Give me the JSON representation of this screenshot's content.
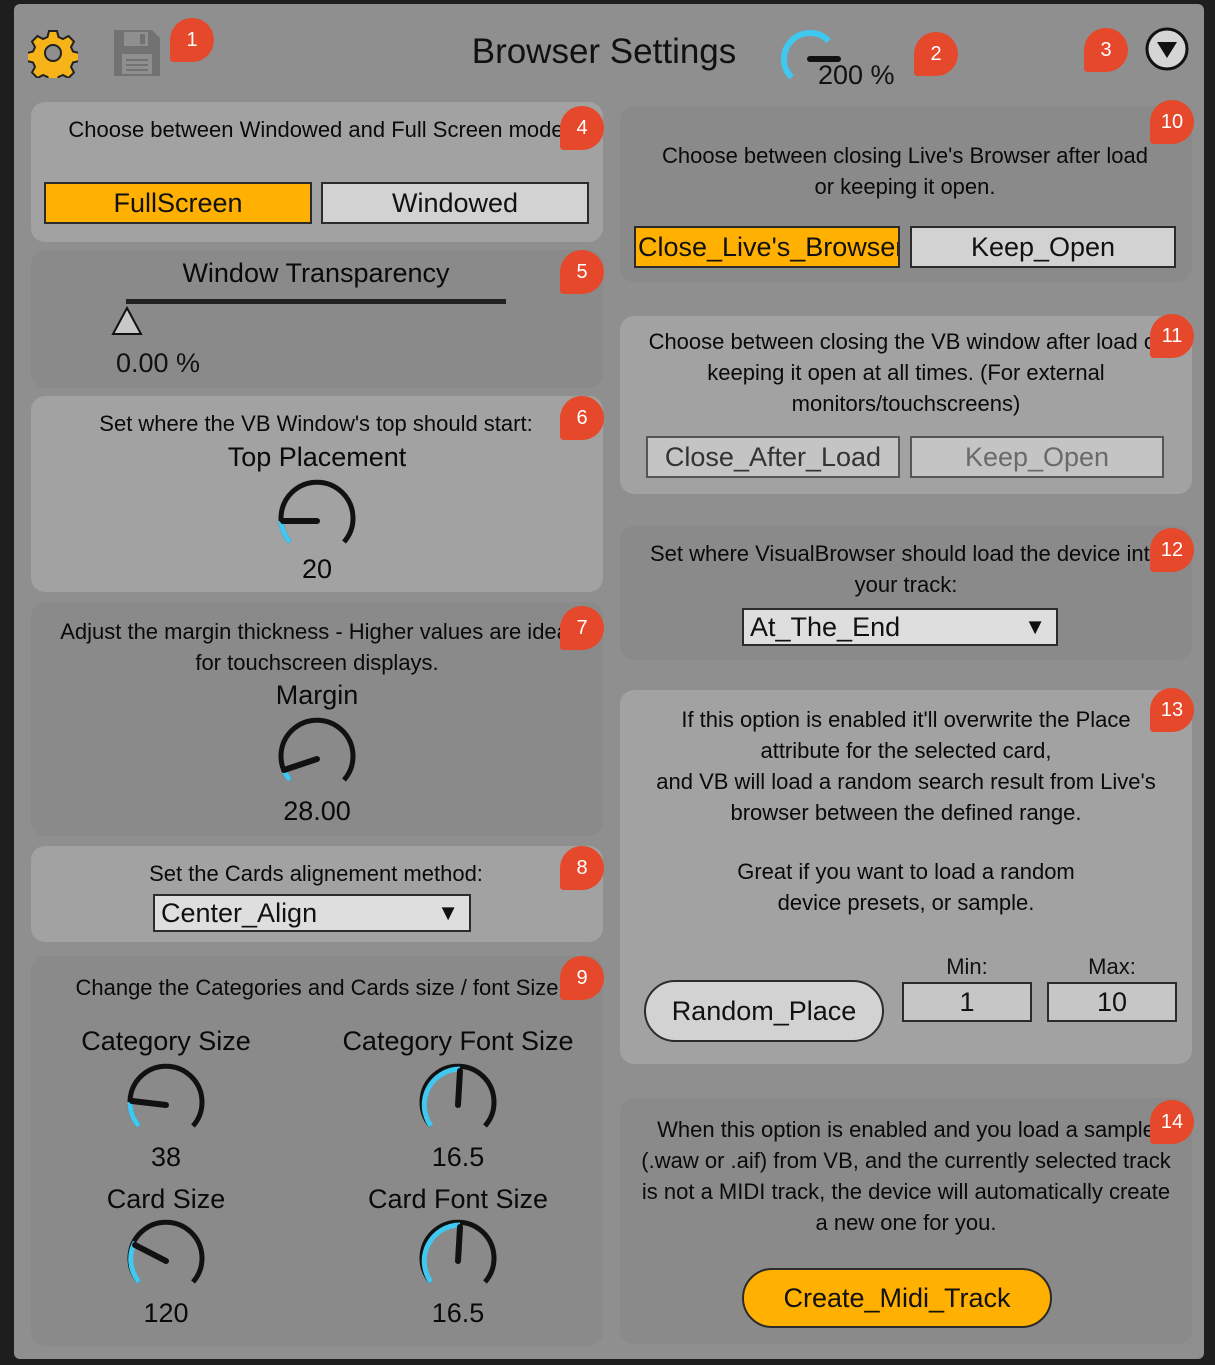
{
  "header": {
    "title": "Browser Settings",
    "zoom": "200 %",
    "icons": [
      "gear-icon",
      "save-icon",
      "collapse-down-icon"
    ]
  },
  "badges": [
    "1",
    "2",
    "3",
    "4",
    "5",
    "6",
    "7",
    "8",
    "9",
    "10",
    "11",
    "12",
    "13",
    "14"
  ],
  "screen_mode": {
    "text": "Choose between Windowed and Full Screen mode",
    "options": [
      "FullScreen",
      "Windowed"
    ],
    "selected": "FullScreen"
  },
  "transparency": {
    "label": "Window Transparency",
    "value": "0.00 %",
    "fraction": 0.0
  },
  "top_placement": {
    "text": "Set where the VB Window's top should start:",
    "label": "Top Placement",
    "value": "20"
  },
  "margin": {
    "text": "Adjust the margin thickness - Higher values are ideal for touchscreen displays.",
    "label": "Margin",
    "value": "28.00"
  },
  "alignment": {
    "text": "Set the Cards alignement method:",
    "selected": "Center_Align"
  },
  "sizes": {
    "text": "Change the Categories and Cards size / font Size",
    "category_size": {
      "label": "Category Size",
      "value": "38"
    },
    "category_font_size": {
      "label": "Category Font Size",
      "value": "16.5"
    },
    "card_size": {
      "label": "Card Size",
      "value": "120"
    },
    "card_font_size": {
      "label": "Card Font Size",
      "value": "16.5"
    }
  },
  "live_browser": {
    "text": "Choose between closing Live's Browser after load or keeping it open.",
    "options": [
      "Close_Live's_Browser",
      "Keep_Open"
    ],
    "selected": "Close_Live's_Browser"
  },
  "vb_window": {
    "text": "Choose between closing the VB window after load or keeping it open at all times. (For external monitors/touchscreens)",
    "options": [
      "Close_After_Load",
      "Keep_Open"
    ]
  },
  "load_position": {
    "text": "Set where VisualBrowser should load the device into your track:",
    "selected": "At_The_End"
  },
  "random_place": {
    "text1": "If this option is enabled it'll overwrite the Place attribute for the selected card,",
    "text2": "and  VB will load a random search result from Live's browser between the defined range.",
    "text3": "Great if you want to load a random device presets, or sample.",
    "button": "Random_Place",
    "min_label": "Min:",
    "max_label": "Max:",
    "min": "1",
    "max": "10"
  },
  "midi_track": {
    "text": "When this option is enabled and you load a sample (.waw or .aif) from VB, and the currently selected track is not a MIDI track, the device will automatically create a new one for you.",
    "button": "Create_Midi_Track"
  },
  "colors": {
    "accent": "#ffb000",
    "knob_arc": "#3fc8f0",
    "badge": "#e5482a"
  }
}
